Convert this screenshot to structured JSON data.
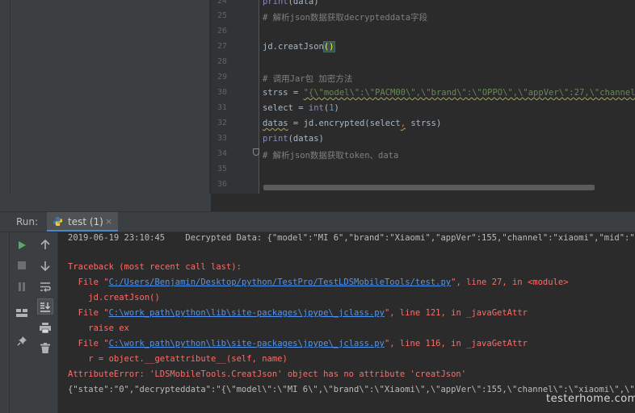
{
  "editor": {
    "line_numbers": [
      "24",
      "25",
      "26",
      "27",
      "28",
      "29",
      "30",
      "31",
      "32",
      "33",
      "34",
      "35",
      "36"
    ],
    "lines": {
      "l24": {
        "fn": "print",
        "rest": "(data)"
      },
      "l25": {
        "comment": "# 解析json数据获取decrypteddata字段"
      },
      "l27": {
        "text": "jd.creatJson",
        "paren": "()"
      },
      "l29": {
        "comment": "# 调用Jar包 加密方法"
      },
      "l30": {
        "var": "strss",
        "op": " = ",
        "str": "\"{\\\"model\\\":\\\"PACM00\\\",\\\"brand\\\":\\\"OPPO\\\",\\\"appVer\\\":27,\\\"channel\\\":\\"
      },
      "l31": {
        "var": "select",
        "op": " = ",
        "fn": "int",
        "open": "(",
        "num": "1",
        "close": ")"
      },
      "l32": {
        "var": "datas",
        "rest": " = jd.encrypted(select",
        "comma": ",",
        "rest2": " strss)"
      },
      "l33": {
        "fn": "print",
        "rest": "(datas)"
      },
      "l34": {
        "comment": "# 解析json数据获取token、data"
      }
    }
  },
  "run": {
    "label": "Run:",
    "tab_label": "test (1)",
    "tab_close": "×"
  },
  "console": {
    "line1": "2019-06-19 23:10:45    Decrypted Data: {\"model\":\"MI 6\",\"brand\":\"Xiaomi\",\"appVer\":155,\"channel\":\"xiaomi\",\"mid\":\"a9d63f",
    "traceback": "Traceback (most recent call last):",
    "f1_pre": "  File \"",
    "f1_link": "C:/Users/Benjamin/Desktop/python/TestPro/TestLDSMobileTools/test.py",
    "f1_post": "\", line 27, in <module>",
    "f1_code": "    jd.creatJson()",
    "f2_pre": "  File \"",
    "f2_link": "C:\\work_path\\python\\lib\\site-packages\\jpype\\_jclass.py",
    "f2_post": "\", line 121, in _javaGetAttr",
    "f2_code": "    raise ex",
    "f3_pre": "  File \"",
    "f3_link": "C:\\work_path\\python\\lib\\site-packages\\jpype\\_jclass.py",
    "f3_post": "\", line 116, in _javaGetAttr",
    "f3_code": "    r = object.__getattribute__(self, name)",
    "error": "AttributeError: 'LDSMobileTools.CreatJson' object has no attribute 'creatJson'",
    "last": "{\"state\":\"0\",\"decrypteddata\":\"{\\\"model\\\":\\\"MI 6\\\",\\\"brand\\\":\\\"Xiaomi\\\",\\\"appVer\\\":155,\\\"channel\\\":\\\"xiaomi\\\",\\\"mid\\\":\\"
  },
  "favorites_label": "vorites",
  "watermark": "testerhome.com",
  "icons": {
    "run": "play-icon",
    "stop": "stop-icon",
    "pause": "pause-icon",
    "layout": "layout-icon",
    "pin": "pin-icon",
    "up": "arrow-up-icon",
    "down": "arrow-down-icon",
    "wrap": "soft-wrap-icon",
    "scroll_end": "scroll-to-end-icon",
    "print": "print-icon",
    "trash": "trash-icon"
  },
  "colors": {
    "error": "#ff6b68",
    "link": "#5394ec",
    "keyword": "#cc7832",
    "comment": "#808080",
    "string": "#6a8759"
  }
}
